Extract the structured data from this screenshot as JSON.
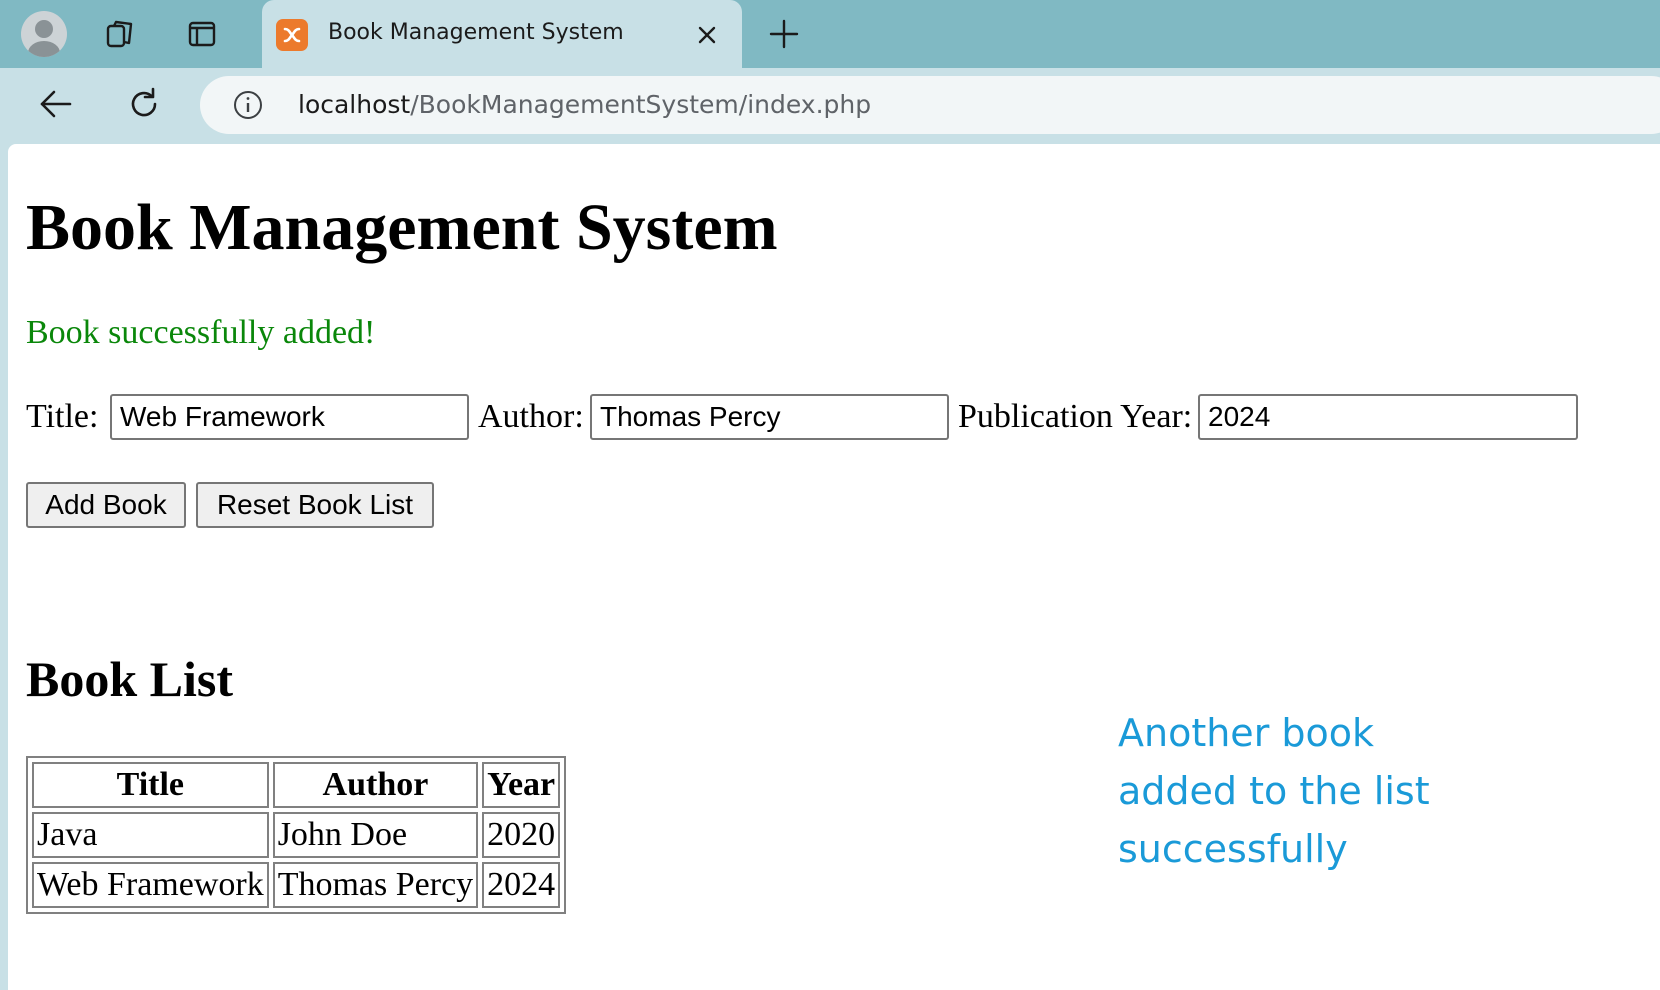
{
  "browser": {
    "tab": {
      "title": "Book Management System",
      "favicon": "xampp-icon"
    },
    "address_bar": {
      "host": "localhost",
      "path": "/BookManagementSystem/index.php"
    },
    "icons": {
      "profile": "profile-icon",
      "workspaces": "workspaces-icon",
      "tab_actions": "tab-actions-icon",
      "close": "close-icon",
      "new_tab": "plus-icon",
      "back": "back-arrow-icon",
      "reload": "reload-icon",
      "info": "info-icon"
    },
    "colors": {
      "tabbar": "#80b9c3",
      "toolbar": "#c8e0e6",
      "favicon": "#ec7a2c"
    }
  },
  "page": {
    "heading": "Book Management System",
    "message": "Book successfully added!",
    "message_color": "#0a870a",
    "form": {
      "title_label": "Title:",
      "title_value": "Web Framework",
      "author_label": "Author:",
      "author_value": "Thomas Percy",
      "year_label": "Publication Year:",
      "year_value": "2024",
      "add_button": "Add Book",
      "reset_button": "Reset Book List"
    },
    "list_heading": "Book List",
    "table": {
      "headers": [
        "Title",
        "Author",
        "Year"
      ],
      "rows": [
        [
          "Java",
          "John Doe",
          "2020"
        ],
        [
          "Web Framework",
          "Thomas Percy",
          "2024"
        ]
      ]
    }
  },
  "annotation": {
    "lines": [
      "Another book",
      "added to the list",
      "successfully"
    ],
    "color": "#1a9ad8"
  }
}
